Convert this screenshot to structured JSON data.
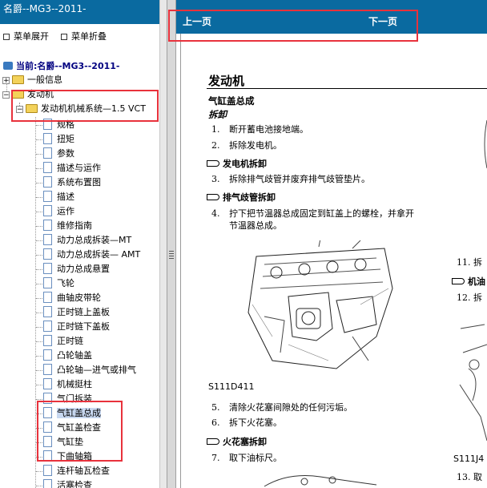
{
  "tree_panel": {
    "title": "名爵--MG3--2011-",
    "expand_label": "菜单展开",
    "collapse_label": "菜单折叠",
    "current_label": "当前:名爵--MG3--2011-",
    "nodes": [
      {
        "label": "一般信息",
        "toggle": "+"
      },
      {
        "label": "发动机",
        "toggle": "−"
      },
      {
        "label": "发动机机械系统—1.5 VCT",
        "toggle": "−"
      }
    ],
    "leaves": [
      "规格",
      "扭矩",
      "参数",
      "描述与运作",
      "系统布置图",
      "描述",
      "运作",
      "维修指南",
      "动力总成拆装—MT",
      "动力总成拆装— AMT",
      "动力总成悬置",
      "飞轮",
      "曲轴皮带轮",
      "正时链上盖板",
      "正时链下盖板",
      "正时链",
      "凸轮轴盖",
      "凸轮轴—进气或排气",
      "机械挺柱",
      "气门拆装",
      "气缸盖总成",
      "气缸盖检查",
      "气缸垫",
      "下曲轴箱",
      "连杆轴瓦检查",
      "活塞检查"
    ]
  },
  "document": {
    "nav_prev": "上一页",
    "nav_next": "下一页",
    "title": "发动机",
    "section": "气缸盖总成",
    "subsection": "拆卸",
    "steps": [
      {
        "n": "1.",
        "text": "断开蓄电池接地端。"
      },
      {
        "n": "2.",
        "text": "拆除发电机。"
      },
      {
        "n": "3.",
        "text": "拆除排气歧管并废弃排气歧管垫片。"
      },
      {
        "n": "4.",
        "text": "拧下把节温器总成固定到缸盖上的螺栓，并拿开"
      },
      {
        "n": "",
        "text": "节温器总成。"
      },
      {
        "n": "5.",
        "text": "清除火花塞间隙处的任何污垢。"
      },
      {
        "n": "6.",
        "text": "拆下火花塞。"
      },
      {
        "n": "7.",
        "text": "取下油标尺。"
      }
    ],
    "refs": [
      "发电机拆卸",
      "排气歧管拆卸",
      "火花塞拆卸"
    ],
    "figure_caption": "S111D411",
    "right_col": {
      "step11": "11.  拆",
      "ref": "机油",
      "step12": "12.  拆",
      "caption": "S111J4",
      "step13": "13.  取"
    }
  }
}
